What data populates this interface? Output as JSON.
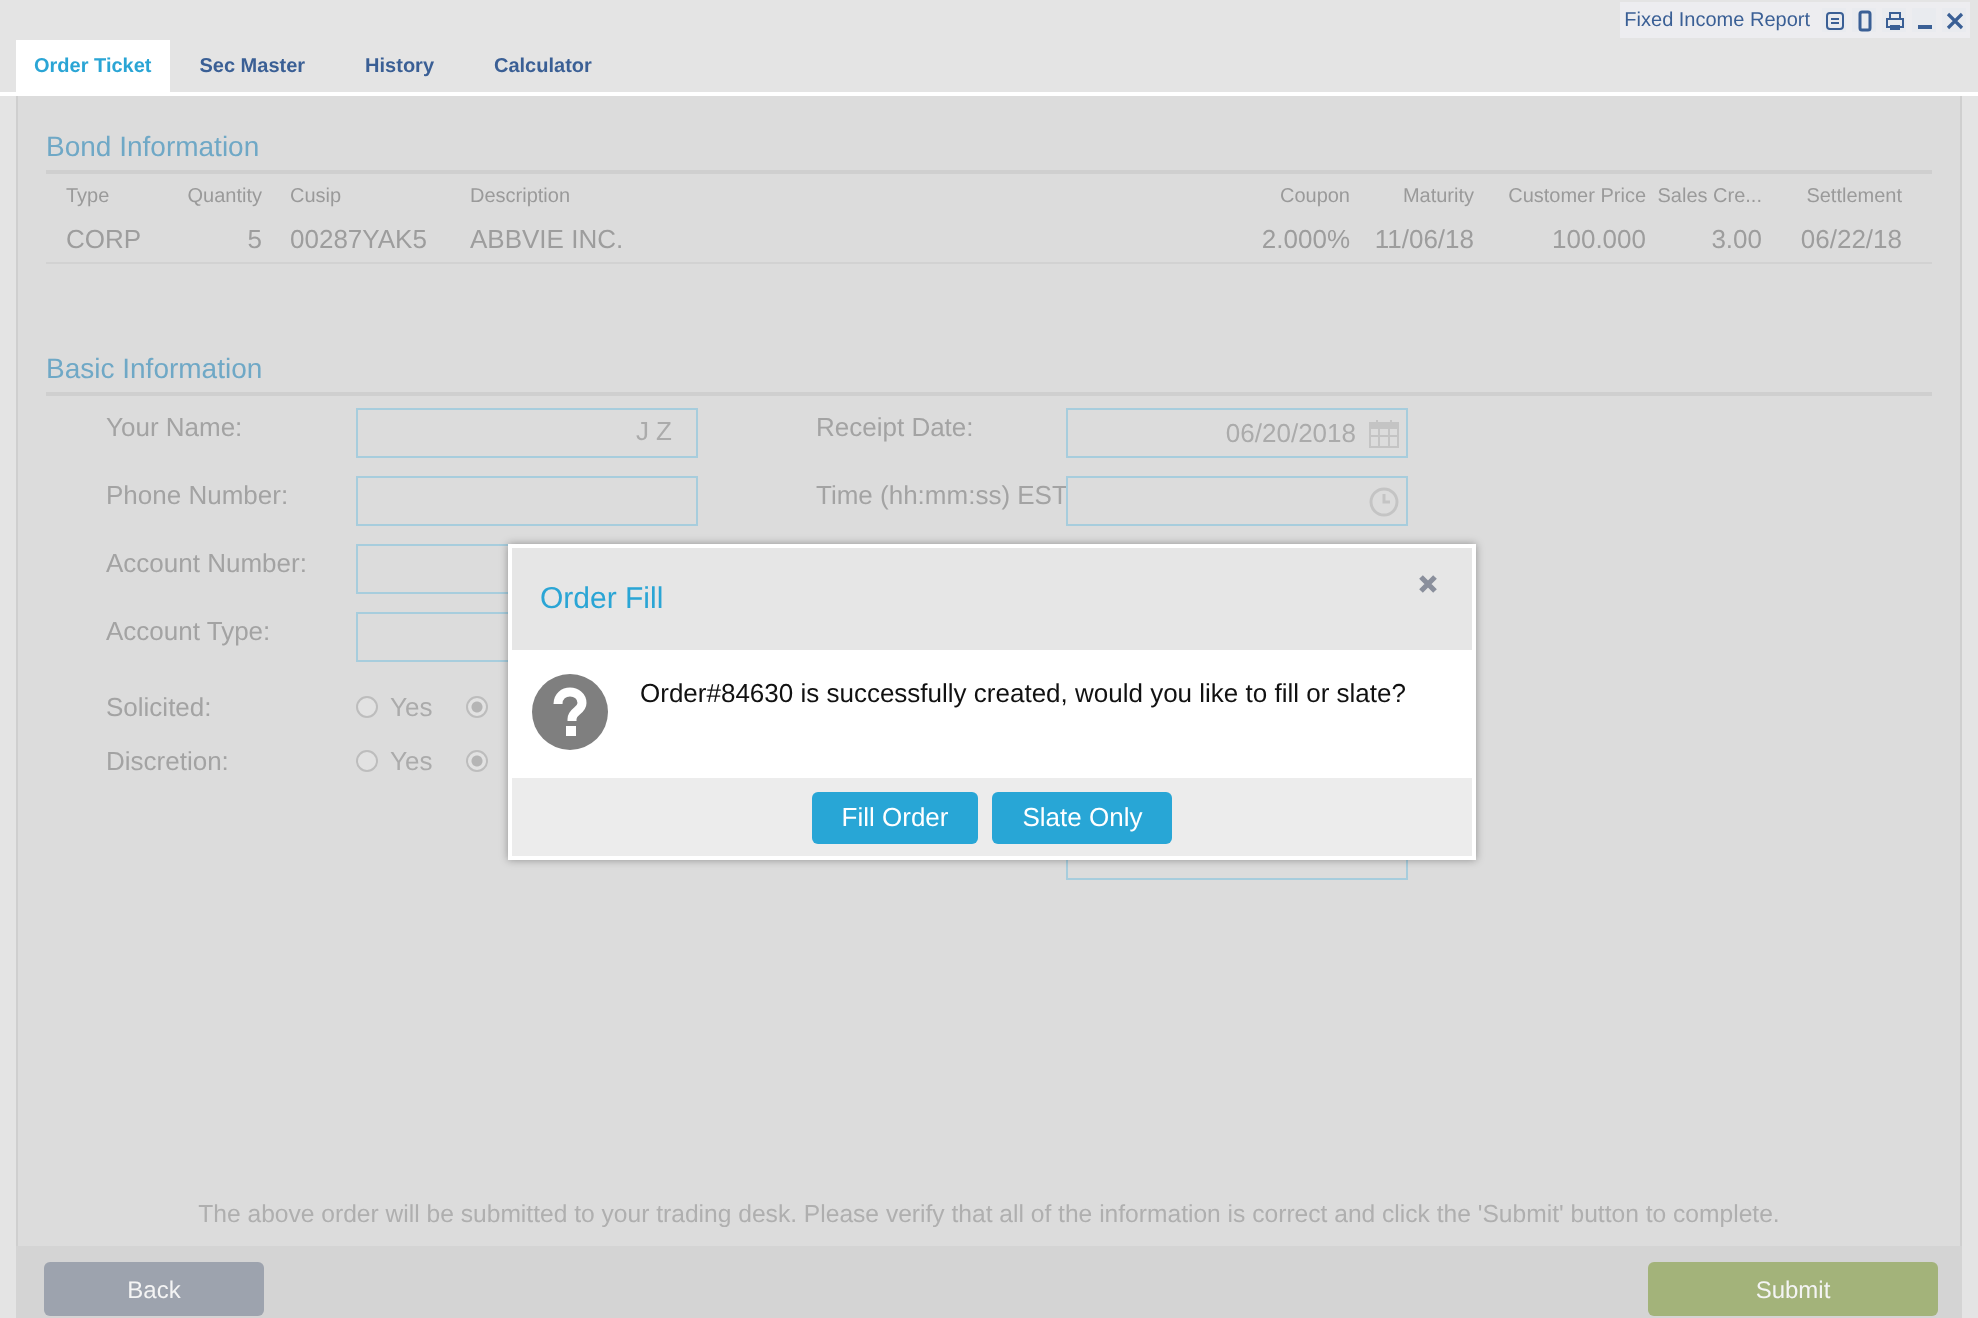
{
  "header": {
    "report_link": "Fixed Income Report"
  },
  "tabs": [
    {
      "label": "Order Ticket",
      "selected": true
    },
    {
      "label": "Sec Master",
      "selected": false
    },
    {
      "label": "History",
      "selected": false
    },
    {
      "label": "Calculator",
      "selected": false
    }
  ],
  "bond_information": {
    "title": "Bond Information",
    "columns": [
      "Type",
      "Quantity",
      "Cusip",
      "Description",
      "Coupon",
      "Maturity",
      "Customer Price",
      "Sales Cre...",
      "Settlement"
    ],
    "rows": [
      [
        "CORP",
        "5",
        "00287YAK5",
        "ABBVIE INC.",
        "2.000%",
        "11/06/18",
        "100.000",
        "3.00",
        "06/22/18"
      ]
    ]
  },
  "basic_information": {
    "title": "Basic Information",
    "left_fields": [
      {
        "label": "Your Name:",
        "value": "J Z"
      },
      {
        "label": "Phone Number:"
      },
      {
        "label": "Account Number:"
      },
      {
        "label": "Account Type:"
      }
    ],
    "radio_groups": [
      {
        "label": "Solicited:",
        "options": [
          {
            "label": "Yes",
            "selected": false
          },
          {
            "selected": true
          }
        ]
      },
      {
        "label": "Discretion:",
        "options": [
          {
            "label": "Yes",
            "selected": false
          },
          {
            "selected": true
          }
        ]
      }
    ],
    "right_fields": [
      {
        "label": "Receipt Date:",
        "value": "06/20/2018",
        "kind": "date"
      },
      {
        "label": "Time (hh:mm:ss) EST",
        "kind": "time"
      }
    ]
  },
  "footer": {
    "note": "The above order will be submitted to your trading desk. Please verify that all of the information is correct and click the 'Submit' button to complete.",
    "buttons": [
      {
        "label": "Back",
        "disabled": true
      },
      {
        "label": "Submit",
        "disabled": true
      }
    ]
  },
  "dialog": {
    "title": "Order Fill",
    "message": "Order#84630 is successfully created, would you like to fill or slate?",
    "buttons": [
      "Fill Order",
      "Slate Only"
    ]
  }
}
